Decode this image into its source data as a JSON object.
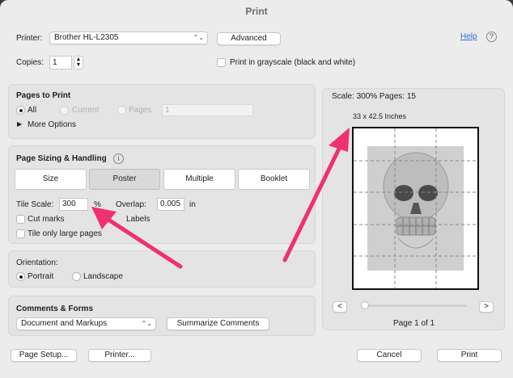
{
  "window": {
    "title": "Print"
  },
  "printer": {
    "label": "Printer:",
    "value": "Brother HL-L2305",
    "advanced_button": "Advanced",
    "help_link": "Help",
    "help_icon": "?"
  },
  "copies": {
    "label": "Copies:",
    "value": "1",
    "grayscale_label": "Print in grayscale (black and white)"
  },
  "pages_to_print": {
    "heading": "Pages to Print",
    "all_label": "All",
    "current_label": "Current",
    "pages_label": "Pages",
    "pages_value": "1",
    "more_options": "More Options",
    "disclosure_icon": "▶"
  },
  "sizing": {
    "heading": "Page Sizing & Handling",
    "info_icon": "i",
    "tabs": [
      "Size",
      "Poster",
      "Multiple",
      "Booklet"
    ],
    "selected_tab": "Poster",
    "tile_scale_label": "Tile Scale:",
    "tile_scale_value": "300",
    "tile_scale_unit": "%",
    "overlap_label": "Overlap:",
    "overlap_value": "0.005",
    "overlap_unit": "in",
    "cut_marks": "Cut marks",
    "labels": "Labels",
    "tile_only_large": "Tile only large pages"
  },
  "orientation": {
    "heading": "Orientation:",
    "portrait": "Portrait",
    "landscape": "Landscape"
  },
  "comments": {
    "heading": "Comments & Forms",
    "select_value": "Document and Markups",
    "summarize_button": "Summarize Comments"
  },
  "preview": {
    "scale_pages": "Scale: 300% Pages: 15",
    "dimensions": "33 x 42.5 Inches",
    "page_indicator": "Page 1 of 1",
    "prev": "<",
    "next": ">"
  },
  "footer": {
    "page_setup": "Page Setup...",
    "printer": "Printer...",
    "cancel": "Cancel",
    "print": "Print"
  },
  "colors": {
    "accent_arrow": "#f0316f",
    "link": "#2f6bd8"
  }
}
